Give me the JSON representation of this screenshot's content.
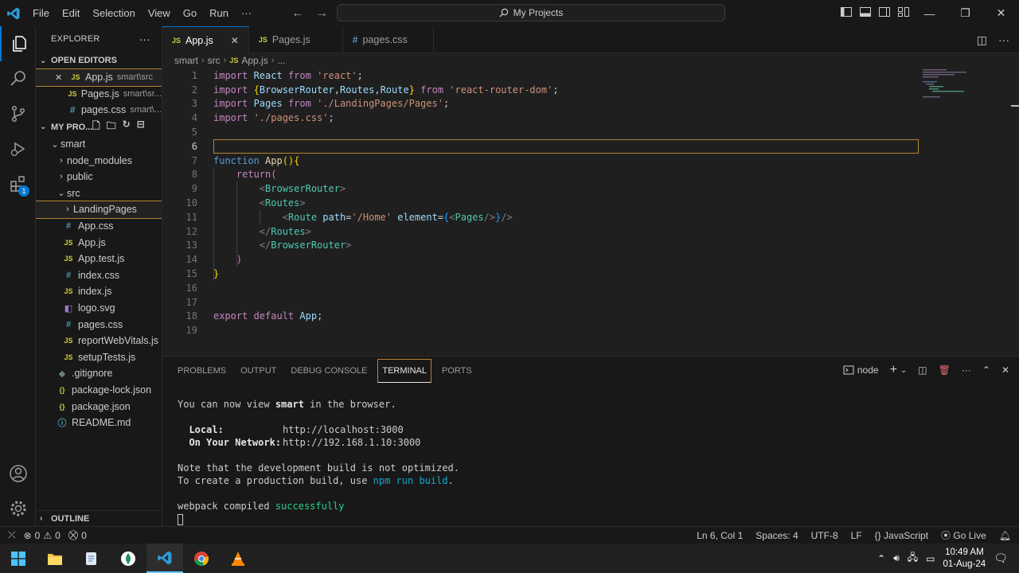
{
  "titlebar": {
    "menu": [
      "File",
      "Edit",
      "Selection",
      "View",
      "Go",
      "Run",
      "···"
    ],
    "search_text": "My Projects"
  },
  "explorer": {
    "title": "EXPLORER",
    "open_editors_label": "OPEN EDITORS",
    "open_editors": [
      {
        "name": "App.js",
        "desc": "smart\\src",
        "type": "js",
        "close": "✕"
      },
      {
        "name": "Pages.js",
        "desc": "smart\\sr...",
        "type": "js",
        "close": ""
      },
      {
        "name": "pages.css",
        "desc": "smart\\...",
        "type": "css",
        "close": ""
      }
    ],
    "project_label": "MY PRO...",
    "tree": [
      {
        "name": "smart",
        "kind": "folder-open",
        "depth": 0
      },
      {
        "name": "node_modules",
        "kind": "folder",
        "depth": 1
      },
      {
        "name": "public",
        "kind": "folder",
        "depth": 1
      },
      {
        "name": "src",
        "kind": "folder-open",
        "depth": 1
      },
      {
        "name": "LandingPages",
        "kind": "folder",
        "depth": 2
      },
      {
        "name": "App.css",
        "kind": "css",
        "depth": 2
      },
      {
        "name": "App.js",
        "kind": "js",
        "depth": 2
      },
      {
        "name": "App.test.js",
        "kind": "js",
        "depth": 2
      },
      {
        "name": "index.css",
        "kind": "css",
        "depth": 2
      },
      {
        "name": "index.js",
        "kind": "js",
        "depth": 2
      },
      {
        "name": "logo.svg",
        "kind": "svg",
        "depth": 2
      },
      {
        "name": "pages.css",
        "kind": "css",
        "depth": 2
      },
      {
        "name": "reportWebVitals.js",
        "kind": "js",
        "depth": 2
      },
      {
        "name": "setupTests.js",
        "kind": "js",
        "depth": 2
      },
      {
        "name": ".gitignore",
        "kind": "git",
        "depth": 1
      },
      {
        "name": "package-lock.json",
        "kind": "json",
        "depth": 1
      },
      {
        "name": "package.json",
        "kind": "json",
        "depth": 1
      },
      {
        "name": "README.md",
        "kind": "info",
        "depth": 1
      }
    ],
    "outline_label": "OUTLINE"
  },
  "tabs": [
    {
      "label": "App.js",
      "active": true,
      "close": "✕"
    },
    {
      "label": "Pages.js",
      "active": false,
      "close": ""
    },
    {
      "label": "pages.css",
      "active": false,
      "close": ""
    }
  ],
  "breadcrumb": [
    "smart",
    "src",
    "App.js",
    "..."
  ],
  "code": {
    "lines": [
      [
        [
          "kw",
          "import "
        ],
        [
          "id",
          "React "
        ],
        [
          "kw",
          "from "
        ],
        [
          "str",
          "'react'"
        ],
        [
          "p",
          ";"
        ]
      ],
      [
        [
          "kw",
          "import "
        ],
        [
          "br1",
          "{"
        ],
        [
          "id",
          "BrowserRouter"
        ],
        [
          "p",
          ","
        ],
        [
          "id",
          "Routes"
        ],
        [
          "p",
          ","
        ],
        [
          "id",
          "Route"
        ],
        [
          "br1",
          "}"
        ],
        [
          "kw",
          " from "
        ],
        [
          "str",
          "'react-router-dom'"
        ],
        [
          "p",
          ";"
        ]
      ],
      [
        [
          "kw",
          "import "
        ],
        [
          "id",
          "Pages "
        ],
        [
          "kw",
          "from "
        ],
        [
          "str",
          "'./LandingPages/Pages'"
        ],
        [
          "p",
          ";"
        ]
      ],
      [
        [
          "kw",
          "import "
        ],
        [
          "str",
          "'./pages.css'"
        ],
        [
          "p",
          ";"
        ]
      ],
      [],
      [],
      [
        [
          "kw2",
          "function "
        ],
        [
          "fn",
          "App"
        ],
        [
          "br1",
          "()"
        ],
        [
          "br1",
          "{"
        ]
      ],
      [
        [
          "p",
          "    "
        ],
        [
          "kw",
          "return"
        ],
        [
          "br2",
          "("
        ]
      ],
      [
        [
          "p",
          "        "
        ],
        [
          "punct",
          "<"
        ],
        [
          "tagname",
          "BrowserRouter"
        ],
        [
          "punct",
          ">"
        ]
      ],
      [
        [
          "p",
          "        "
        ],
        [
          "punct",
          "<"
        ],
        [
          "tagname",
          "Routes"
        ],
        [
          "punct",
          ">"
        ]
      ],
      [
        [
          "p",
          "            "
        ],
        [
          "punct",
          "<"
        ],
        [
          "tagname",
          "Route "
        ],
        [
          "attr",
          "path"
        ],
        [
          "p",
          "="
        ],
        [
          "str",
          "'/Home' "
        ],
        [
          "attr",
          "element"
        ],
        [
          "p",
          "="
        ],
        [
          "br3",
          "{"
        ],
        [
          "punct",
          "<"
        ],
        [
          "tagname",
          "Pages"
        ],
        [
          "punct",
          "/>"
        ],
        [
          "br3",
          "}"
        ],
        [
          "punct",
          "/>"
        ]
      ],
      [
        [
          "p",
          "        "
        ],
        [
          "punct",
          "</"
        ],
        [
          "tagname",
          "Routes"
        ],
        [
          "punct",
          ">"
        ]
      ],
      [
        [
          "p",
          "        "
        ],
        [
          "punct",
          "</"
        ],
        [
          "tagname",
          "BrowserRouter"
        ],
        [
          "punct",
          ">"
        ]
      ],
      [
        [
          "p",
          "    "
        ],
        [
          "br2",
          ")"
        ]
      ],
      [
        [
          "br1",
          "}"
        ]
      ],
      [],
      [],
      [
        [
          "kw",
          "export "
        ],
        [
          "kw",
          "default "
        ],
        [
          "id",
          "App"
        ],
        [
          "p",
          ";"
        ]
      ],
      []
    ],
    "current_line": 6
  },
  "panel": {
    "tabs": [
      "PROBLEMS",
      "OUTPUT",
      "DEBUG CONSOLE",
      "TERMINAL",
      "PORTS"
    ],
    "active_tab": "TERMINAL",
    "terminal_name": "node",
    "terminal": {
      "l1a": "You can now view ",
      "l1b": "smart",
      "l1c": " in the browser.",
      "local_label": "  Local:",
      "local_url": "http://localhost:3000",
      "net_label": "  On Your Network:",
      "net_url": "http://192.168.1.10:3000",
      "note1": "Note that the development build is not optimized.",
      "note2a": "To create a production build, use ",
      "note2b": "npm run build",
      "note2c": ".",
      "compiled_a": "webpack compiled ",
      "compiled_b": "successfully"
    }
  },
  "statusbar": {
    "errors": "0",
    "warnings": "0",
    "ports": "0",
    "position": "Ln 6, Col 1",
    "spaces": "Spaces: 4",
    "encoding": "UTF-8",
    "eol": "LF",
    "language": "JavaScript",
    "golive": "Go Live"
  },
  "taskbar": {
    "time": "10:49 AM",
    "date": "01-Aug-24"
  },
  "colors": {
    "accent": "#0078d4",
    "focus_border": "#b5842f",
    "editor_bg": "#1f1f1f",
    "chrome_bg": "#181818"
  }
}
